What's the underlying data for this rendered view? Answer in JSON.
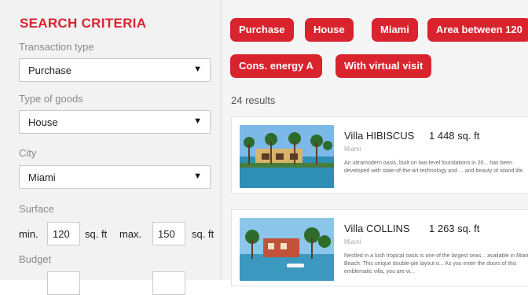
{
  "sidebar": {
    "title": "SEARCH CRITERIA",
    "transaction": {
      "label": "Transaction type",
      "value": "Purchase"
    },
    "goods": {
      "label": "Type of goods",
      "value": "House"
    },
    "city": {
      "label": "City",
      "value": "Miami"
    },
    "surface": {
      "label": "Surface",
      "min_label": "min.",
      "min_value": "120",
      "min_unit": "sq. ft",
      "max_label": "max.",
      "max_value": "150",
      "max_unit": "sq. ft"
    },
    "budget": {
      "label": "Budget"
    }
  },
  "filters": [
    "Purchase",
    "House",
    "Miami",
    "Area between 120",
    "Cons. energy A",
    "With virtual visit"
  ],
  "results_count": "24 results",
  "listings": [
    {
      "name": "Villa HIBISCUS",
      "area": "1 448 sq. ft",
      "city": "Miami",
      "description": "An ultramodern oasis, built on two-level foundations in 20... has been developed with state-of-the-art technology and ... and beauty of island life."
    },
    {
      "name": "Villa COLLINS",
      "area": "1 263 sq. ft",
      "city": "Miami",
      "description": "Nestled in a lush tropical oasis is one of the largest seas... available in Miami Beach. This unique double-pie layout o... As you enter the doors of this emblematic villa, you are w..."
    }
  ],
  "icons": {
    "dropdown": "triangle-down-icon"
  },
  "colors": {
    "accent": "#d9232d",
    "sidebar_bg": "#f2f2f2",
    "main_bg": "#f5f5f5"
  }
}
